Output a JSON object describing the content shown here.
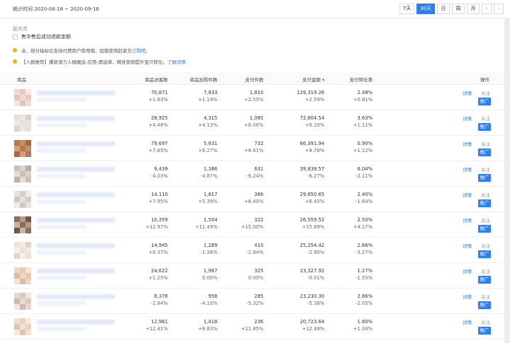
{
  "header": {
    "stat_period": "统计时间 2020-08-18 ~ 2020-09-16",
    "ranges": [
      "7天",
      "30天",
      "日",
      "周",
      "月"
    ],
    "active_range": "30天",
    "prev_icon": "chevron-left-icon",
    "next_icon": "chevron-right-icon"
  },
  "filters": {
    "service_label": "服务类",
    "checkbox_label": "售中售后成功退款金额"
  },
  "notices": [
    {
      "text": "亲，部分指标仅支持付费用户使用哦，如需使用赶紧去 ",
      "link": "订购吧。"
    },
    {
      "text": "【人群推荐】爆款潜力人群圈选-应用-再选择，精准营销提升宝贝转化。",
      "link": "了解详情"
    }
  ],
  "colors": {
    "accent": "#2d7df4",
    "notice_dot": "#f5b019"
  },
  "table": {
    "columns": [
      "商品",
      "商品访客数",
      "商品加购件数",
      "支付件数",
      "支付金额",
      "支付转化率",
      "操作"
    ],
    "sorted_column_icon": "sort-down-icon",
    "actions": {
      "detail": "详情",
      "follow": "关注",
      "promote": "推广"
    },
    "rows": [
      {
        "visitors": "70,871",
        "visitors_chg": "+1.83%",
        "cart": "7,833",
        "cart_chg": "+1.14%",
        "pay_qty": "1,810",
        "pay_qty_chg": "+2.55%",
        "amount": "129,319.26",
        "amount_chg": "+2.59%",
        "conv": "2.48%",
        "conv_chg": "+0.81%"
      },
      {
        "visitors": "28,925",
        "visitors_chg": "+4.46%",
        "cart": "4,315",
        "cart_chg": "+4.13%",
        "pay_qty": "1,085",
        "pay_qty_chg": "+6.06%",
        "amount": "72,604.54",
        "amount_chg": "+6.10%",
        "conv": "3.63%",
        "conv_chg": "+1.11%"
      },
      {
        "visitors": "79,697",
        "visitors_chg": "+7.65%",
        "cart": "5,631",
        "cart_chg": "+6.27%",
        "pay_qty": "732",
        "pay_qty_chg": "+8.61%",
        "amount": "66,391.94",
        "amount_chg": "+8.78%",
        "conv": "0.90%",
        "conv_chg": "+1.12%"
      },
      {
        "visitors": "9,439",
        "visitors_chg": "-4.03%",
        "cart": "1,386",
        "cart_chg": "-4.87%",
        "pay_qty": "631",
        "pay_qty_chg": "-6.24%",
        "amount": "39,838.57",
        "amount_chg": "-6.27%",
        "conv": "6.04%",
        "conv_chg": "-2.11%"
      },
      {
        "visitors": "14,110",
        "visitors_chg": "+7.95%",
        "cart": "1,817",
        "cart_chg": "+5.39%",
        "pay_qty": "366",
        "pay_qty_chg": "+6.40%",
        "amount": "29,650.65",
        "amount_chg": "+6.45%",
        "conv": "2.40%",
        "conv_chg": "-1.64%"
      },
      {
        "visitors": "10,359",
        "visitors_chg": "+12.97%",
        "cart": "1,504",
        "cart_chg": "+11.49%",
        "pay_qty": "322",
        "pay_qty_chg": "+15.00%",
        "amount": "26,559.52",
        "amount_chg": "+15.89%",
        "conv": "2.50%",
        "conv_chg": "+4.17%"
      },
      {
        "visitors": "14,945",
        "visitors_chg": "+0.37%",
        "cart": "1,289",
        "cart_chg": "-1.38%",
        "pay_qty": "410",
        "pay_qty_chg": "-2.84%",
        "amount": "25,254.42",
        "amount_chg": "-2.90%",
        "conv": "2.66%",
        "conv_chg": "-3.27%"
      },
      {
        "visitors": "24,622",
        "visitors_chg": "+1.25%",
        "cart": "1,967",
        "cart_chg": "0.00%",
        "pay_qty": "325",
        "pay_qty_chg": "0.00%",
        "amount": "23,327.92",
        "amount_chg": "-0.01%",
        "conv": "1.27%",
        "conv_chg": "-1.55%"
      },
      {
        "visitors": "8,378",
        "visitors_chg": "-2.84%",
        "cart": "958",
        "cart_chg": "-4.10%",
        "pay_qty": "285",
        "pay_qty_chg": "-5.32%",
        "amount": "23,230.30",
        "amount_chg": "-5.38%",
        "conv": "2.86%",
        "conv_chg": "-2.05%"
      },
      {
        "visitors": "12,961",
        "visitors_chg": "+12.41%",
        "cart": "1,418",
        "cart_chg": "+8.83%",
        "pay_qty": "236",
        "pay_qty_chg": "+11.85%",
        "amount": "20,723.64",
        "amount_chg": "+12.48%",
        "conv": "1.80%",
        "conv_chg": "+1.34%"
      }
    ]
  }
}
